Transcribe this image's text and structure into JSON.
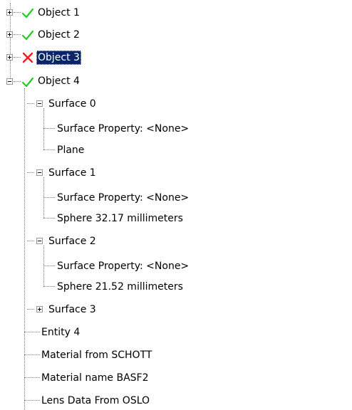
{
  "tree": {
    "objects": [
      {
        "label": "Object 1",
        "status": "check-icon",
        "expanded": false
      },
      {
        "label": "Object 2",
        "status": "check-icon",
        "expanded": false
      },
      {
        "label": "Object 3",
        "status": "error-x-icon",
        "expanded": false,
        "selected": true
      },
      {
        "label": "Object 4",
        "status": "check-icon",
        "expanded": true
      }
    ],
    "object4_children": {
      "surface0": {
        "label": "Surface 0",
        "property": "Surface Property: <None>",
        "shape": "Plane"
      },
      "surface1": {
        "label": "Surface 1",
        "property": "Surface Property: <None>",
        "shape": "Sphere 32.17 millimeters"
      },
      "surface2": {
        "label": "Surface 2",
        "property": "Surface Property: <None>",
        "shape": "Sphere 21.52 millimeters"
      },
      "surface3": {
        "label": "Surface 3"
      },
      "entity": "Entity 4",
      "material_source": "Material from SCHOTT",
      "material_name": "Material name BASF2",
      "lens_data": "Lens Data From OSLO"
    }
  },
  "colors": {
    "check": "#22cc22",
    "error": "#ff1a1a",
    "selection": "#0a246a",
    "tree_lines": "#808080",
    "expander_border": "#919b9c"
  }
}
